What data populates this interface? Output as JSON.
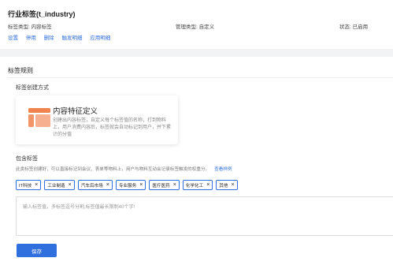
{
  "header": {
    "title": "行业标签(t_industry)",
    "tag_type": "标签类型: 内容标签",
    "manage_type": "管理类型: 自定义",
    "status": "状态: 已启用",
    "actions": [
      "设置",
      "停用",
      "删除",
      "触发明细",
      "应用明细"
    ]
  },
  "rules": {
    "section_title": "标签规则",
    "create_method_title": "标签创建方式",
    "card": {
      "title": "内容特征定义",
      "description": "创建出内容标签，自定义每个标签值的名称，打到物料上，用户消费内容后，标签就会自动标记到用户，并下累计的分值",
      "icon": "layout-icon"
    },
    "include_title": "包含标签",
    "hint": "此类标签创建好，可以直接标记到会议、表单等物料上，用户与物料互动会记录标签触发的权重分。",
    "hint_link": "查看样例",
    "tags": [
      "IT科技",
      "工业制造",
      "汽车后市场",
      "专业服务",
      "医疗医药",
      "化学化工",
      "其他"
    ],
    "input_placeholder": "输入标签值，多标签逗号分割,标签值最长限制40个字!",
    "save_label": "保存"
  },
  "colors": {
    "accent": "#2f6fde",
    "icon": "#f0834e"
  }
}
